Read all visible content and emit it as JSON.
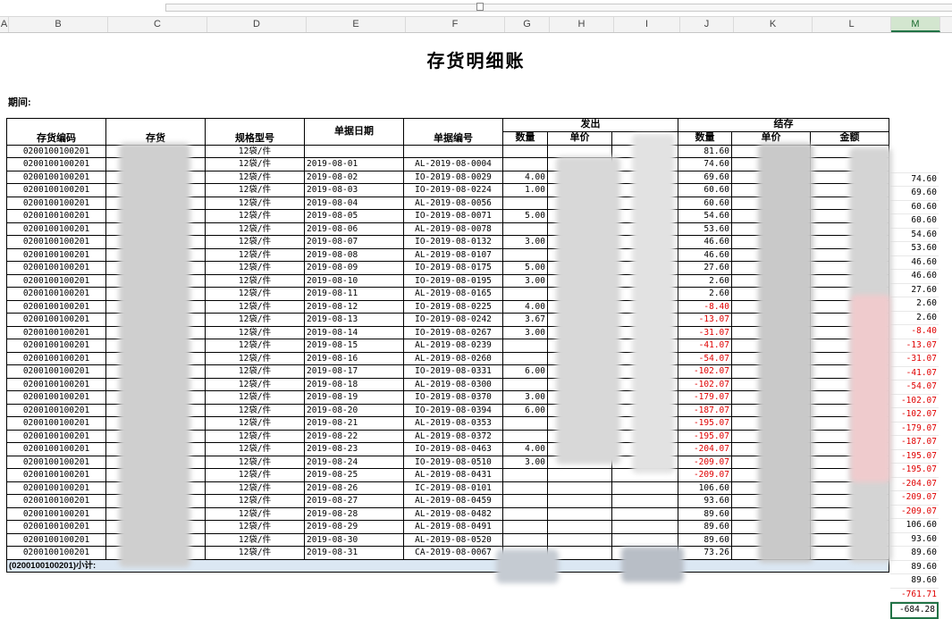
{
  "columns": [
    "A",
    "B",
    "C",
    "D",
    "E",
    "F",
    "G",
    "H",
    "I",
    "J",
    "K",
    "L",
    "M"
  ],
  "selected_column": "M",
  "title": "存货明细账",
  "period_label": "期间:",
  "headers": {
    "code": "存货编码",
    "item": "存货",
    "spec": "规格型号",
    "date": "单据日期",
    "docno": "单据编号",
    "issue": "发出",
    "balance": "结存",
    "qty": "数量",
    "price": "单价",
    "qty2": "数量",
    "price2": "单价",
    "amount": "金额"
  },
  "rows": [
    {
      "code": "0200100100201",
      "spec": "12袋/件",
      "date": "",
      "doc": "",
      "qty": "",
      "bal": "81.60",
      "m": ""
    },
    {
      "code": "0200100100201",
      "spec": "12袋/件",
      "date": "2019-08-01",
      "doc": "AL-2019-08-0004",
      "qty": "",
      "bal": "74.60",
      "m": "74.60"
    },
    {
      "code": "0200100100201",
      "spec": "12袋/件",
      "date": "2019-08-02",
      "doc": "IO-2019-08-0029",
      "qty": "4.00",
      "bal": "69.60",
      "m": "69.60"
    },
    {
      "code": "0200100100201",
      "spec": "12袋/件",
      "date": "2019-08-03",
      "doc": "IO-2019-08-0224",
      "qty": "1.00",
      "bal": "60.60",
      "m": "60.60"
    },
    {
      "code": "0200100100201",
      "spec": "12袋/件",
      "date": "2019-08-04",
      "doc": "AL-2019-08-0056",
      "qty": "",
      "bal": "60.60",
      "m": "60.60"
    },
    {
      "code": "0200100100201",
      "spec": "12袋/件",
      "date": "2019-08-05",
      "doc": "IO-2019-08-0071",
      "qty": "5.00",
      "bal": "54.60",
      "m": "54.60"
    },
    {
      "code": "0200100100201",
      "spec": "12袋/件",
      "date": "2019-08-06",
      "doc": "AL-2019-08-0078",
      "qty": "",
      "bal": "53.60",
      "m": "53.60"
    },
    {
      "code": "0200100100201",
      "spec": "12袋/件",
      "date": "2019-08-07",
      "doc": "IO-2019-08-0132",
      "qty": "3.00",
      "bal": "46.60",
      "m": "46.60"
    },
    {
      "code": "0200100100201",
      "spec": "12袋/件",
      "date": "2019-08-08",
      "doc": "AL-2019-08-0107",
      "qty": "",
      "bal": "46.60",
      "m": "46.60"
    },
    {
      "code": "0200100100201",
      "spec": "12袋/件",
      "date": "2019-08-09",
      "doc": "IO-2019-08-0175",
      "qty": "5.00",
      "bal": "27.60",
      "m": "27.60"
    },
    {
      "code": "0200100100201",
      "spec": "12袋/件",
      "date": "2019-08-10",
      "doc": "IO-2019-08-0195",
      "qty": "3.00",
      "bal": "2.60",
      "m": "2.60"
    },
    {
      "code": "0200100100201",
      "spec": "12袋/件",
      "date": "2019-08-11",
      "doc": "AL-2019-08-0165",
      "qty": "",
      "bal": "2.60",
      "m": "2.60"
    },
    {
      "code": "0200100100201",
      "spec": "12袋/件",
      "date": "2019-08-12",
      "doc": "IO-2019-08-0225",
      "qty": "4.00",
      "bal": "-8.40",
      "m": "-8.40"
    },
    {
      "code": "0200100100201",
      "spec": "12袋/件",
      "date": "2019-08-13",
      "doc": "IO-2019-08-0242",
      "qty": "3.67",
      "bal": "-13.07",
      "m": "-13.07"
    },
    {
      "code": "0200100100201",
      "spec": "12袋/件",
      "date": "2019-08-14",
      "doc": "IO-2019-08-0267",
      "qty": "3.00",
      "bal": "-31.07",
      "m": "-31.07"
    },
    {
      "code": "0200100100201",
      "spec": "12袋/件",
      "date": "2019-08-15",
      "doc": "AL-2019-08-0239",
      "qty": "",
      "bal": "-41.07",
      "m": "-41.07"
    },
    {
      "code": "0200100100201",
      "spec": "12袋/件",
      "date": "2019-08-16",
      "doc": "AL-2019-08-0260",
      "qty": "",
      "bal": "-54.07",
      "m": "-54.07"
    },
    {
      "code": "0200100100201",
      "spec": "12袋/件",
      "date": "2019-08-17",
      "doc": "IO-2019-08-0331",
      "qty": "6.00",
      "bal": "-102.07",
      "m": "-102.07"
    },
    {
      "code": "0200100100201",
      "spec": "12袋/件",
      "date": "2019-08-18",
      "doc": "AL-2019-08-0300",
      "qty": "",
      "bal": "-102.07",
      "m": "-102.07"
    },
    {
      "code": "0200100100201",
      "spec": "12袋/件",
      "date": "2019-08-19",
      "doc": "IO-2019-08-0370",
      "qty": "3.00",
      "bal": "-179.07",
      "m": "-179.07"
    },
    {
      "code": "0200100100201",
      "spec": "12袋/件",
      "date": "2019-08-20",
      "doc": "IO-2019-08-0394",
      "qty": "6.00",
      "bal": "-187.07",
      "m": "-187.07"
    },
    {
      "code": "0200100100201",
      "spec": "12袋/件",
      "date": "2019-08-21",
      "doc": "AL-2019-08-0353",
      "qty": "",
      "bal": "-195.07",
      "m": "-195.07"
    },
    {
      "code": "0200100100201",
      "spec": "12袋/件",
      "date": "2019-08-22",
      "doc": "AL-2019-08-0372",
      "qty": "",
      "bal": "-195.07",
      "m": "-195.07"
    },
    {
      "code": "0200100100201",
      "spec": "12袋/件",
      "date": "2019-08-23",
      "doc": "IO-2019-08-0463",
      "qty": "4.00",
      "bal": "-204.07",
      "m": "-204.07"
    },
    {
      "code": "0200100100201",
      "spec": "12袋/件",
      "date": "2019-08-24",
      "doc": "IO-2019-08-0510",
      "qty": "3.00",
      "bal": "-209.07",
      "m": "-209.07"
    },
    {
      "code": "0200100100201",
      "spec": "12袋/件",
      "date": "2019-08-25",
      "doc": "AL-2019-08-0431",
      "qty": "",
      "bal": "-209.07",
      "m": "-209.07"
    },
    {
      "code": "0200100100201",
      "spec": "12袋/件",
      "date": "2019-08-26",
      "doc": "IC-2019-08-0101",
      "qty": "",
      "bal": "106.60",
      "m": "106.60"
    },
    {
      "code": "0200100100201",
      "spec": "12袋/件",
      "date": "2019-08-27",
      "doc": "AL-2019-08-0459",
      "qty": "",
      "bal": "93.60",
      "m": "93.60"
    },
    {
      "code": "0200100100201",
      "spec": "12袋/件",
      "date": "2019-08-28",
      "doc": "AL-2019-08-0482",
      "qty": "",
      "bal": "89.60",
      "m": "89.60"
    },
    {
      "code": "0200100100201",
      "spec": "12袋/件",
      "date": "2019-08-29",
      "doc": "AL-2019-08-0491",
      "qty": "",
      "bal": "89.60",
      "m": "89.60"
    },
    {
      "code": "0200100100201",
      "spec": "12袋/件",
      "date": "2019-08-30",
      "doc": "AL-2019-08-0520",
      "qty": "",
      "bal": "89.60",
      "m": "89.60"
    },
    {
      "code": "0200100100201",
      "spec": "12袋/件",
      "date": "2019-08-31",
      "doc": "CA-2019-08-0067",
      "qty": "",
      "bal": "73.26",
      "m": "-761.71"
    }
  ],
  "subtotal": {
    "label": "(0200100100201)小计:",
    "m": "-684.28"
  },
  "colors": {
    "negative": "#e00000",
    "subtotal_bg": "#dbe7f3",
    "selected_col": "#217346"
  }
}
